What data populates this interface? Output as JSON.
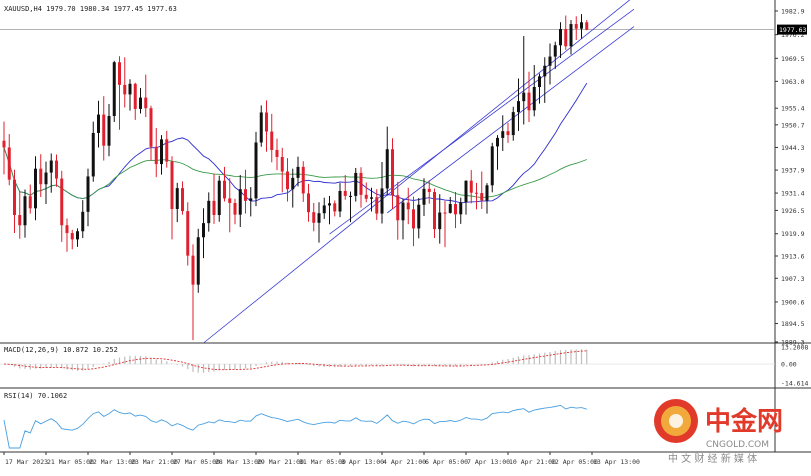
{
  "colors": {
    "bull": "#111111",
    "bear": "#e0202e",
    "ma_fast": "#2b2bd0",
    "ma_slow": "#3a9a4a",
    "channel": "#3a3ad8",
    "macd_line": "#e03030",
    "macd_hist": "#bdbdbd",
    "rsi": "#4aa0e0",
    "axis": "#333333",
    "price_box": "#000000",
    "watermark_red": "#e23a2a",
    "watermark_gold": "#f2a93b"
  },
  "chart_data": {
    "type": "candlestick",
    "title": "XAUUSD,H4 1979.70 1980.34 1977.45 1977.63",
    "symbol": "XAUUSD",
    "timeframe": "H4",
    "ohlc_header": {
      "open": 1979.7,
      "high": 1980.34,
      "low": 1977.45,
      "close": 1977.63
    },
    "current_price": 1977.63,
    "ylim": [
      1889.0,
      1986.0
    ],
    "y_ticks": [
      "1982.9",
      "1976.2",
      "1969.5",
      "1963.0",
      "1955.4",
      "1950.7",
      "1944.3",
      "1937.9",
      "1931.4",
      "1926.5",
      "1919.9",
      "1913.6",
      "1907.3",
      "1900.6",
      "1894.5",
      "1889.3"
    ],
    "y_tick_values": [
      1982.9,
      1976.2,
      1969.5,
      1963.0,
      1955.4,
      1950.7,
      1944.3,
      1937.9,
      1931.4,
      1926.5,
      1919.9,
      1913.6,
      1907.3,
      1900.6,
      1894.5,
      1889.3
    ],
    "x_ticks": [
      "17 Mar 2023",
      "21 Mar 05:00",
      "22 Mar 13:00",
      "23 Mar 21:00",
      "27 Mar 05:00",
      "28 Mar 13:00",
      "29 Mar 21:00",
      "31 Mar 05:00",
      "3 Apr 13:00",
      "4 Apr 21:00",
      "6 Apr 05:00",
      "7 Apr 13:00",
      "10 Apr 21:00",
      "12 Apr 05:00",
      "13 Apr 13:00"
    ],
    "x_tick_index": [
      0,
      8,
      16,
      24,
      32,
      40,
      48,
      56,
      64,
      72,
      80,
      88,
      96,
      104,
      112
    ],
    "candles": [
      [
        1946.2,
        1951.6,
        1936.7,
        1944.3
      ],
      [
        1944.3,
        1948.1,
        1933.6,
        1935.2
      ],
      [
        1935.2,
        1938.0,
        1920.1,
        1925.2
      ],
      [
        1925.2,
        1932.0,
        1918.5,
        1922.3
      ],
      [
        1922.3,
        1932.4,
        1918.8,
        1930.5
      ],
      [
        1930.5,
        1933.8,
        1925.6,
        1927.1
      ],
      [
        1927.1,
        1941.8,
        1923.7,
        1938.3
      ],
      [
        1938.3,
        1942.4,
        1930.3,
        1933.9
      ],
      [
        1933.9,
        1940.3,
        1928.3,
        1937.2
      ],
      [
        1937.2,
        1942.6,
        1931.5,
        1940.6
      ],
      [
        1940.6,
        1942.3,
        1933.2,
        1935.5
      ],
      [
        1935.5,
        1937.7,
        1917.6,
        1922.3
      ],
      [
        1922.3,
        1924.2,
        1914.8,
        1920.1
      ],
      [
        1920.1,
        1921.0,
        1915.5,
        1918.3
      ],
      [
        1918.3,
        1921.4,
        1916.2,
        1920.6
      ],
      [
        1920.6,
        1929.4,
        1918.7,
        1926.1
      ],
      [
        1926.1,
        1938.3,
        1922.0,
        1936.1
      ],
      [
        1936.1,
        1951.6,
        1934.6,
        1948.4
      ],
      [
        1948.4,
        1957.5,
        1944.3,
        1953.6
      ],
      [
        1953.6,
        1958.8,
        1940.6,
        1944.8
      ],
      [
        1944.8,
        1956.6,
        1941.8,
        1953.2
      ],
      [
        1953.2,
        1968.8,
        1951.5,
        1968.4
      ],
      [
        1968.4,
        1970.1,
        1949.3,
        1962.0
      ],
      [
        1962.0,
        1969.8,
        1955.6,
        1959.3
      ],
      [
        1959.3,
        1963.6,
        1954.7,
        1962.3
      ],
      [
        1962.3,
        1962.6,
        1952.1,
        1955.2
      ],
      [
        1955.2,
        1961.1,
        1953.9,
        1958.4
      ],
      [
        1958.4,
        1964.9,
        1952.9,
        1955.4
      ],
      [
        1955.4,
        1956.1,
        1940.6,
        1944.5
      ],
      [
        1944.5,
        1949.8,
        1935.9,
        1939.6
      ],
      [
        1939.6,
        1947.8,
        1936.6,
        1946.6
      ],
      [
        1946.6,
        1949.0,
        1938.6,
        1940.3
      ],
      [
        1940.3,
        1941.8,
        1918.3,
        1926.9
      ],
      [
        1926.9,
        1934.3,
        1923.2,
        1932.8
      ],
      [
        1932.8,
        1934.7,
        1925.3,
        1926.3
      ],
      [
        1926.3,
        1928.8,
        1910.9,
        1913.7
      ],
      [
        1913.7,
        1916.9,
        1889.8,
        1905.5
      ],
      [
        1905.5,
        1921.3,
        1903.2,
        1918.9
      ],
      [
        1918.9,
        1927.1,
        1913.0,
        1922.9
      ],
      [
        1922.9,
        1931.6,
        1920.5,
        1929.2
      ],
      [
        1929.2,
        1936.9,
        1922.7,
        1925.2
      ],
      [
        1925.2,
        1936.3,
        1923.3,
        1934.9
      ],
      [
        1934.9,
        1938.8,
        1929.0,
        1929.9
      ],
      [
        1929.9,
        1935.6,
        1920.3,
        1928.6
      ],
      [
        1928.6,
        1929.8,
        1922.6,
        1925.3
      ],
      [
        1925.3,
        1936.5,
        1921.8,
        1932.5
      ],
      [
        1932.5,
        1938.0,
        1925.6,
        1929.2
      ],
      [
        1929.2,
        1933.1,
        1924.8,
        1929.9
      ],
      [
        1929.9,
        1948.7,
        1927.7,
        1945.7
      ],
      [
        1945.7,
        1956.2,
        1944.5,
        1954.2
      ],
      [
        1954.2,
        1957.6,
        1943.1,
        1948.8
      ],
      [
        1948.8,
        1953.8,
        1940.1,
        1943.6
      ],
      [
        1943.6,
        1946.8,
        1937.9,
        1941.6
      ],
      [
        1941.6,
        1944.2,
        1931.6,
        1937.5
      ],
      [
        1937.5,
        1941.3,
        1929.0,
        1932.5
      ],
      [
        1932.5,
        1938.3,
        1927.3,
        1935.7
      ],
      [
        1935.7,
        1941.7,
        1933.3,
        1938.8
      ],
      [
        1938.8,
        1940.4,
        1928.9,
        1931.3
      ],
      [
        1931.3,
        1934.0,
        1923.3,
        1926.0
      ],
      [
        1926.0,
        1928.6,
        1920.6,
        1923.0
      ],
      [
        1923.0,
        1928.8,
        1917.4,
        1925.7
      ],
      [
        1925.7,
        1930.1,
        1924.1,
        1927.9
      ],
      [
        1927.9,
        1930.6,
        1922.6,
        1928.5
      ],
      [
        1928.5,
        1929.3,
        1924.8,
        1926.2
      ],
      [
        1926.2,
        1934.2,
        1924.6,
        1932.0
      ],
      [
        1932.0,
        1936.5,
        1929.5,
        1930.6
      ],
      [
        1930.6,
        1931.8,
        1923.2,
        1930.6
      ],
      [
        1930.6,
        1938.5,
        1929.0,
        1937.1
      ],
      [
        1937.1,
        1938.7,
        1927.3,
        1930.9
      ],
      [
        1930.9,
        1934.4,
        1928.8,
        1929.8
      ],
      [
        1929.8,
        1932.9,
        1926.2,
        1930.2
      ],
      [
        1930.2,
        1932.5,
        1923.8,
        1925.6
      ],
      [
        1925.6,
        1940.2,
        1922.8,
        1932.7
      ],
      [
        1932.7,
        1950.2,
        1930.7,
        1943.8
      ],
      [
        1943.8,
        1946.9,
        1926.9,
        1930.8
      ],
      [
        1930.8,
        1934.6,
        1918.2,
        1923.7
      ],
      [
        1923.7,
        1929.8,
        1918.3,
        1928.7
      ],
      [
        1928.7,
        1932.9,
        1922.6,
        1926.8
      ],
      [
        1926.8,
        1930.4,
        1916.4,
        1921.4
      ],
      [
        1921.4,
        1930.0,
        1918.6,
        1928.1
      ],
      [
        1928.1,
        1935.6,
        1924.9,
        1932.6
      ],
      [
        1932.6,
        1935.0,
        1928.4,
        1931.7
      ],
      [
        1931.7,
        1932.7,
        1918.7,
        1921.2
      ],
      [
        1921.2,
        1931.1,
        1917.1,
        1925.9
      ],
      [
        1925.9,
        1929.2,
        1916.1,
        1925.8
      ],
      [
        1925.8,
        1930.3,
        1925.6,
        1928.3
      ],
      [
        1928.3,
        1931.7,
        1921.5,
        1925.4
      ],
      [
        1925.4,
        1930.1,
        1922.7,
        1928.8
      ],
      [
        1928.8,
        1935.0,
        1925.3,
        1934.9
      ],
      [
        1934.9,
        1937.9,
        1928.5,
        1931.5
      ],
      [
        1931.5,
        1934.3,
        1926.8,
        1931.4
      ],
      [
        1931.4,
        1937.5,
        1926.9,
        1929.3
      ],
      [
        1929.3,
        1934.2,
        1925.6,
        1933.6
      ],
      [
        1933.6,
        1945.6,
        1931.6,
        1944.6
      ],
      [
        1944.6,
        1947.8,
        1938.0,
        1947.0
      ],
      [
        1947.0,
        1953.4,
        1943.3,
        1948.9
      ],
      [
        1948.9,
        1951.3,
        1945.6,
        1947.8
      ],
      [
        1947.8,
        1955.8,
        1946.2,
        1954.3
      ],
      [
        1954.3,
        1963.8,
        1949.0,
        1957.4
      ],
      [
        1957.4,
        1975.8,
        1950.8,
        1959.8
      ],
      [
        1959.8,
        1965.7,
        1951.5,
        1954.8
      ],
      [
        1954.8,
        1967.6,
        1953.1,
        1961.4
      ],
      [
        1961.4,
        1965.2,
        1956.7,
        1964.4
      ],
      [
        1964.4,
        1969.8,
        1956.9,
        1967.4
      ],
      [
        1967.4,
        1973.7,
        1962.1,
        1970.0
      ],
      [
        1970.0,
        1974.2,
        1966.5,
        1973.2
      ],
      [
        1973.2,
        1979.7,
        1969.6,
        1977.8
      ],
      [
        1977.8,
        1981.6,
        1971.9,
        1972.9
      ],
      [
        1972.9,
        1980.3,
        1970.6,
        1979.2
      ],
      [
        1979.2,
        1981.4,
        1974.7,
        1977.9
      ],
      [
        1977.9,
        1982.0,
        1975.1,
        1979.7
      ],
      [
        1979.7,
        1980.34,
        1977.45,
        1977.63
      ]
    ],
    "channel_lines": [
      {
        "name": "",
        "from": {
          "x": 38,
          "y": 1889.0
        },
        "to": {
          "x": 120,
          "y": 1987.0
        }
      },
      {
        "name": "",
        "from": {
          "x": 62,
          "y": 1919.8
        },
        "to": {
          "x": 120,
          "y": 1983.4
        }
      },
      {
        "name": "",
        "from": {
          "x": 73,
          "y": 1925.8
        },
        "to": {
          "x": 120,
          "y": 1978.5
        }
      }
    ],
    "macd_panel": {
      "title": "MACD(12,26,9) 10.872 10.252",
      "ylim": [
        -14.61,
        13.21
      ],
      "y_ticks": [
        "13.2008",
        "0.00",
        "-14.614"
      ],
      "signal_min": -14.61,
      "signal_max": 13.21
    },
    "rsi_panel": {
      "title": "RSI(14) 70.1062",
      "ylim": [
        0,
        100
      ]
    },
    "grid": false,
    "legend": "none"
  },
  "watermark": {
    "brand": "中金网",
    "site": "CNGOLD.COM",
    "tagline": "中 文 财 经 新 媒 体"
  }
}
